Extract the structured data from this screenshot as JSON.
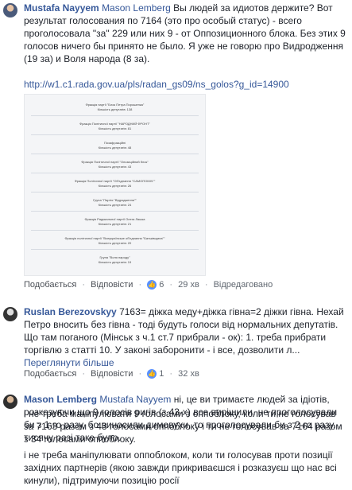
{
  "comments": [
    {
      "author": "Mustafa Nayyem",
      "mention": "Mason Lemberg",
      "text": "Вы людей за идиотов держите? Вот результат голосования по 7164 (это про особый статус) - всего проголосовала \"за\" 229 или них 9 - от Оппозиционного блока. Без этих 9 голосов ничего бы принято не было. Я уже не говорю про Видродження (19 за) и Воля народа (8 за).",
      "link": "http://w1.c1.rada.gov.ua/pls/radan_gs09/ns_golos?g_id=14900",
      "actions": {
        "like": "Подобається",
        "reply": "Відповісти",
        "reaction_count": "6",
        "time": "29 хв",
        "edited": "Відредаговано"
      }
    },
    {
      "author": "Ruslan Berezovskyy",
      "text": "7163= діжка меду+діжка гівна=2 діжки гівна. Нехай Петро вносить без гівна - тоді будуть голоси від нормальних депутатів. Що там поганого (Мінськ з ч.1 ст.7 прибрали - ок): 1. треба прибрати торгівлю з статті 10. У законі заборонити - і все, дозволити л...",
      "see_more": "Переглянути більше",
      "actions": {
        "like": "Подобається",
        "reply": "Відповісти",
        "reaction_count": "1",
        "time": "32 хв"
      }
    },
    {
      "author": "Mason Lemberg",
      "mention": "Mustafa Nayyem",
      "text": "ні, це ви тримаєте людей за ідіотів, розказуючи що 9 голосів ригів (з 43-х) все вирішили. не проголосували би з 1-го разу, бо виносили димовухи, то проголосували би з 2-го разу. тисячу разі таке було.",
      "paragraphs": [
        "і не треба маніпулювати 9 голосами з оппоблоку, коли ти не голосував за 7163 разом з 43 голосами оппоблоку і ти не голосував за 7164 разом з 34 голосами оппоблоку.",
        "і не треба маніпулювати оппоблоком, коли ти голосував проти позиції західних партнерів (якою завжди прикриваєшся і розказуєш що нас всі кинули), підтримуючи позицію росії"
      ]
    }
  ]
}
